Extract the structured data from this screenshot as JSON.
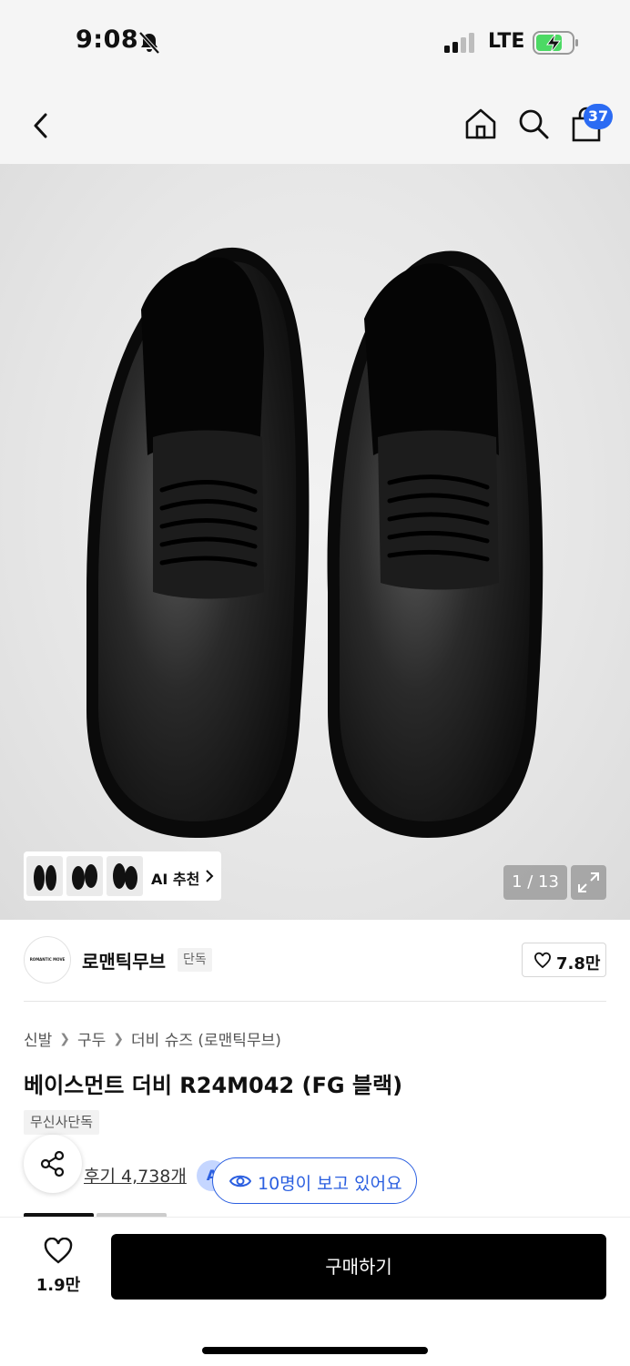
{
  "status_bar": {
    "time": "9:08",
    "network": "LTE",
    "icons": [
      "bell-slash-icon",
      "signal-icon",
      "battery-charging-icon"
    ]
  },
  "nav": {
    "icons": [
      "back-icon",
      "home-icon",
      "search-icon",
      "bag-icon"
    ],
    "bag_count": "37"
  },
  "gallery": {
    "ai_recommend_label": "AI 추천",
    "page_counter": "1 / 13"
  },
  "brand": {
    "logo_text": "ROMANTIC MOVE",
    "name": "로맨틱무브",
    "badge": "단독",
    "like_count": "7.8만"
  },
  "breadcrumb": [
    "신발",
    "구두",
    "더비 슈즈 (로맨틱무브)"
  ],
  "product": {
    "title": "베이스먼트 더비 R24M042 (FG 블랙)",
    "tag": "무신사단독",
    "review_link": "후기 4,738개",
    "ai_chip": "A",
    "viewers": "10명이 보고 있어요"
  },
  "bottom_bar": {
    "wish_count": "1.9만",
    "buy_label": "구매하기"
  },
  "colors": {
    "accent_blue": "#2b5fe0",
    "badge_blue": "#2b6bf3",
    "buy_button": "#000000",
    "battery_green": "#4cd964"
  }
}
